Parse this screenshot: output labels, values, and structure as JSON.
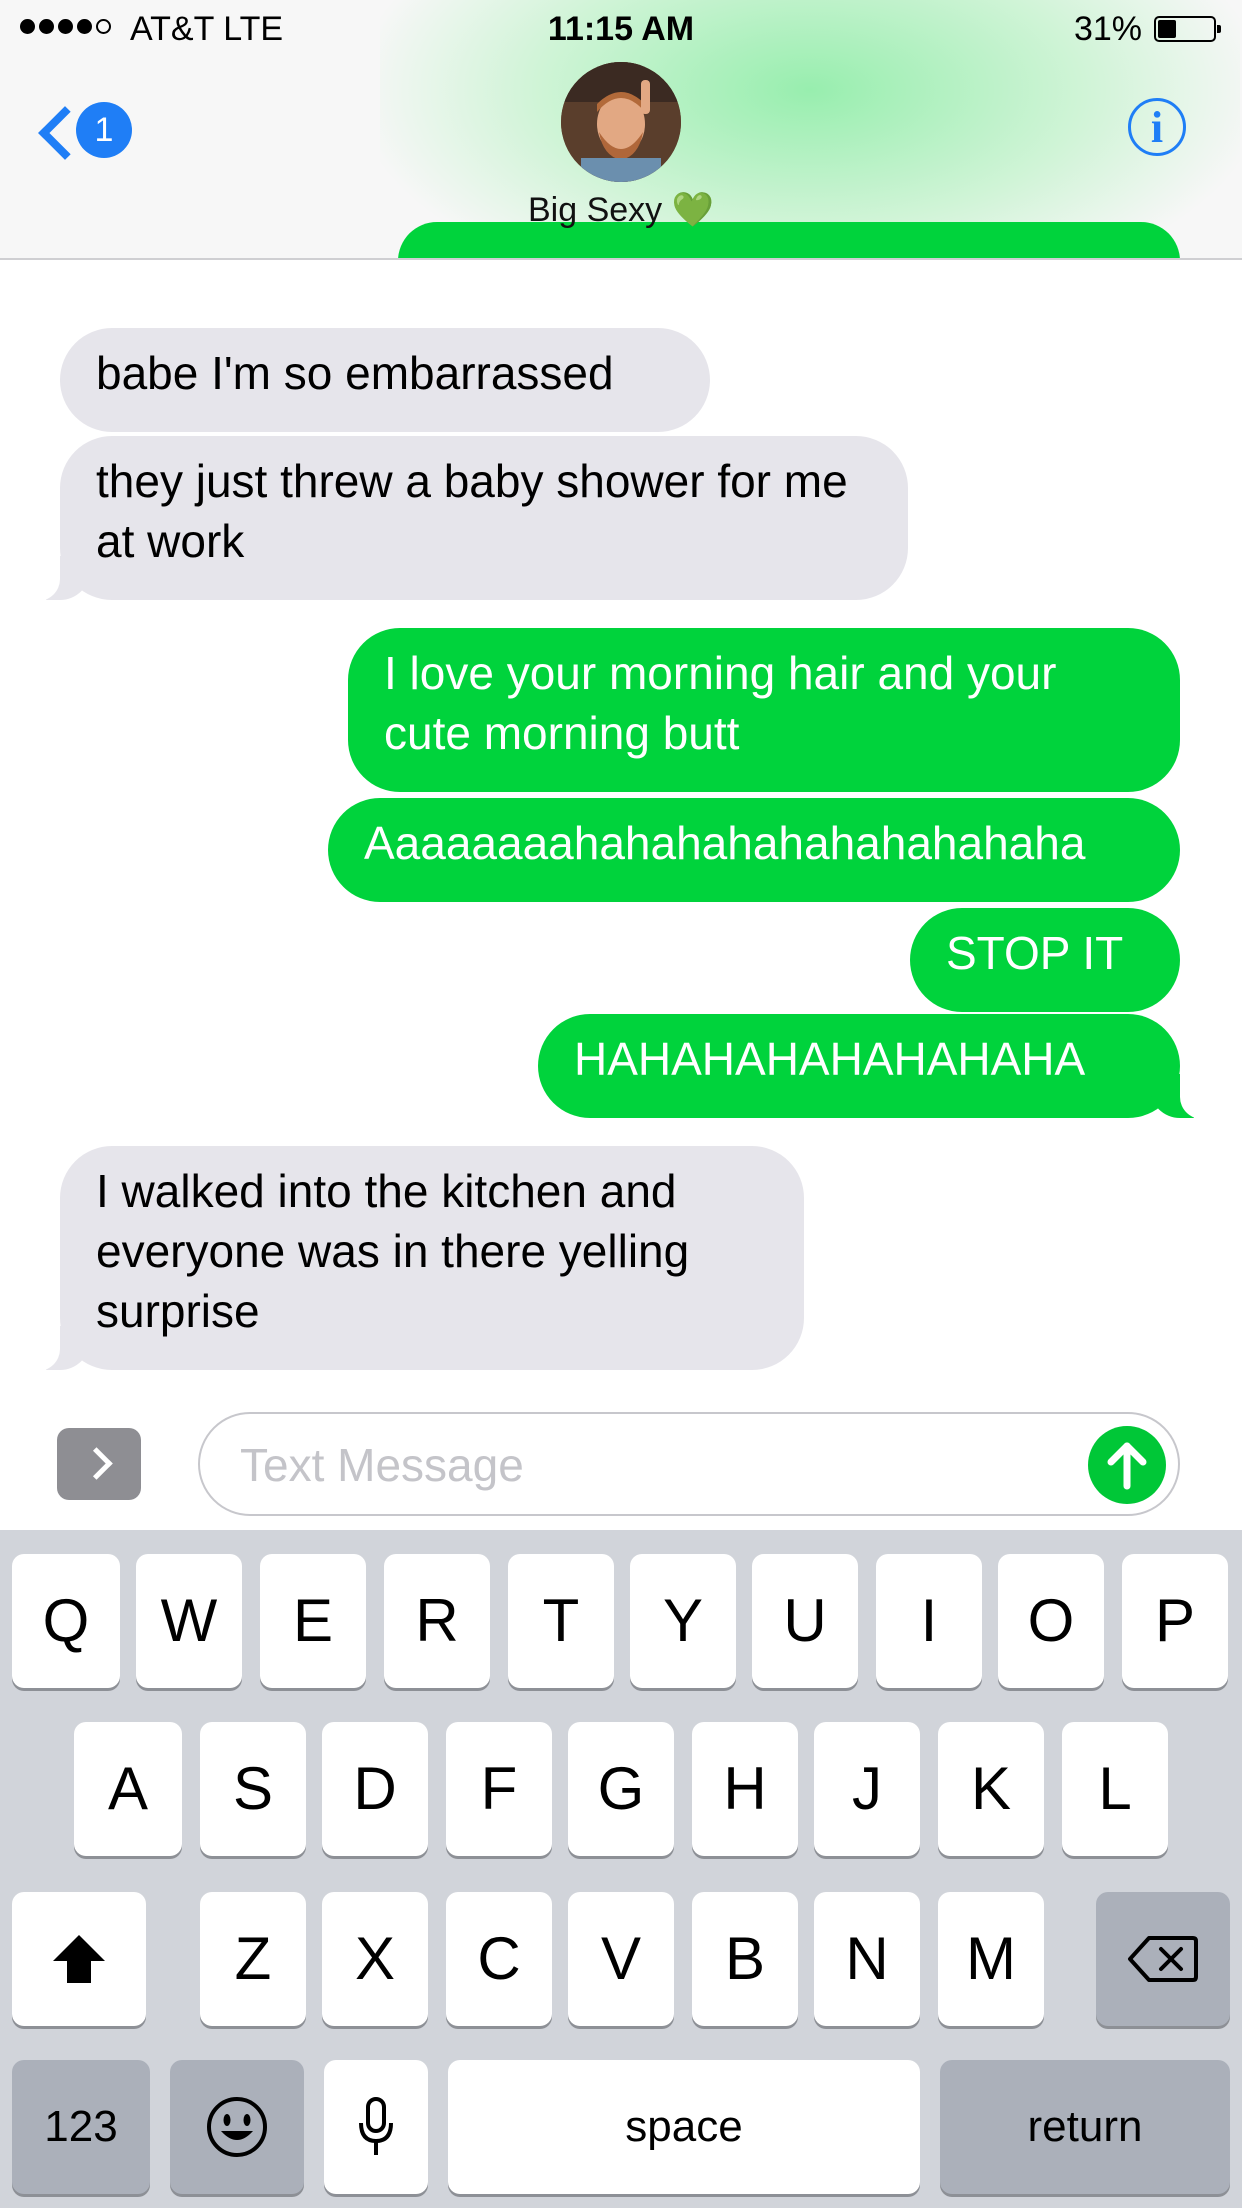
{
  "status_bar": {
    "carrier": "AT&T   LTE",
    "time": "11:15 AM",
    "battery": "31%",
    "battery_level": 0.31,
    "signal_bars": 4
  },
  "header": {
    "back_badge": "1",
    "contact_name": "Big Sexy",
    "contact_emoji": "💚",
    "info_icon": "i",
    "icons": [
      "back-chevron-icon",
      "info-icon",
      "contact-avatar"
    ]
  },
  "messages": [
    {
      "direction": "incoming",
      "text": "babe I'm so embarrassed"
    },
    {
      "direction": "incoming",
      "text": "they just threw a baby shower for me at work"
    },
    {
      "direction": "outgoing",
      "text": "I love your morning hair and your cute morning butt"
    },
    {
      "direction": "outgoing",
      "text": "Aaaaaaaahahahahahahahahahaha"
    },
    {
      "direction": "outgoing",
      "text": "STOP IT"
    },
    {
      "direction": "outgoing",
      "text": "HAHAHAHAHAHAHAHA"
    },
    {
      "direction": "incoming",
      "text": "I walked into the kitchen and everyone was in there yelling surprise"
    }
  ],
  "composer": {
    "placeholder": "Text Message",
    "value": "",
    "icons": [
      "apps-chevron-icon",
      "send-arrow-icon"
    ]
  },
  "keyboard": {
    "row1": [
      "Q",
      "W",
      "E",
      "R",
      "T",
      "Y",
      "U",
      "I",
      "O",
      "P"
    ],
    "row2": [
      "A",
      "S",
      "D",
      "F",
      "G",
      "H",
      "J",
      "K",
      "L"
    ],
    "row3": [
      "Z",
      "X",
      "C",
      "V",
      "B",
      "N",
      "M"
    ],
    "numbers_label": "123",
    "space_label": "space",
    "return_label": "return",
    "icons": [
      "shift-icon",
      "backspace-icon",
      "emoji-icon",
      "microphone-icon"
    ]
  },
  "colors": {
    "outgoing_bubble": "#00d33c",
    "incoming_bubble": "#e6e5eb",
    "accent_blue": "#1f7ef6",
    "send_button": "#00c737",
    "keyboard_bg": "#d1d4da"
  }
}
